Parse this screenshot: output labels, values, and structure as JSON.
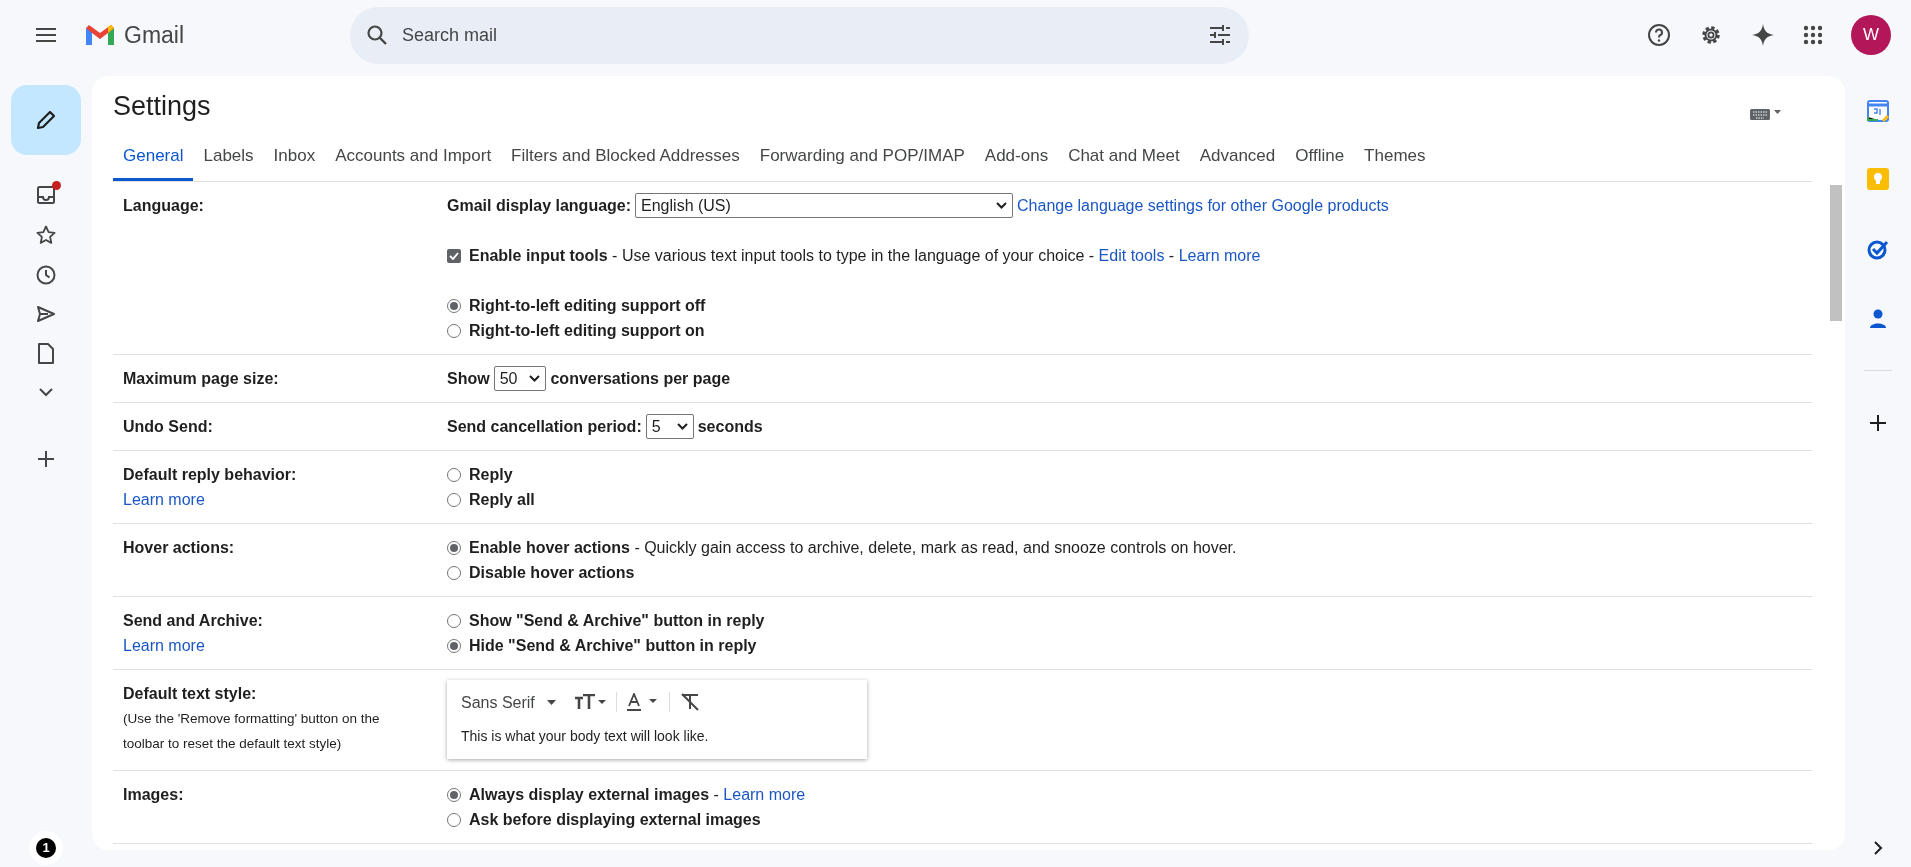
{
  "app": {
    "name": "Gmail"
  },
  "search": {
    "placeholder": "Search mail"
  },
  "account": {
    "initial": "W"
  },
  "nav": {
    "unread_dot": true
  },
  "bottom_badge": "1",
  "page_title": "Settings",
  "tabs": [
    {
      "label": "General",
      "selected": true
    },
    {
      "label": "Labels",
      "selected": false
    },
    {
      "label": "Inbox",
      "selected": false
    },
    {
      "label": "Accounts and Import",
      "selected": false
    },
    {
      "label": "Filters and Blocked Addresses",
      "selected": false
    },
    {
      "label": "Forwarding and POP/IMAP",
      "selected": false
    },
    {
      "label": "Add-ons",
      "selected": false
    },
    {
      "label": "Chat and Meet",
      "selected": false
    },
    {
      "label": "Advanced",
      "selected": false
    },
    {
      "label": "Offline",
      "selected": false
    },
    {
      "label": "Themes",
      "selected": false
    }
  ],
  "settings": [
    {
      "label": "Language:",
      "items": [
        {
          "kind": "line",
          "segments": [
            {
              "kind": "strong",
              "text": "Gmail display language:"
            },
            {
              "kind": "wide-select",
              "text": "English (US)"
            },
            {
              "kind": "link",
              "text": "Change language settings for other Google products"
            }
          ]
        },
        {
          "kind": "checkbox",
          "checked": true,
          "segments": [
            {
              "kind": "strong",
              "text": "Enable input tools"
            },
            {
              "kind": "text",
              "text": " - Use various text input tools to type in the language of your choice - "
            },
            {
              "kind": "link",
              "text": "Edit tools"
            },
            {
              "kind": "text",
              "text": " - "
            },
            {
              "kind": "link",
              "text": "Learn more"
            }
          ]
        },
        {
          "kind": "radio",
          "selected": true,
          "segments": [
            {
              "kind": "strong",
              "text": "Right-to-left editing support off"
            }
          ]
        },
        {
          "kind": "radio",
          "selected": false,
          "segments": [
            {
              "kind": "strong",
              "text": "Right-to-left editing support on"
            }
          ]
        }
      ]
    },
    {
      "label": "Maximum page size:",
      "items": [
        {
          "kind": "line",
          "segments": [
            {
              "kind": "strong",
              "text": "Show"
            },
            {
              "kind": "select",
              "text": "50"
            },
            {
              "kind": "strong",
              "text": "conversations per page"
            }
          ]
        }
      ]
    },
    {
      "label": "Undo Send:",
      "items": [
        {
          "kind": "line",
          "segments": [
            {
              "kind": "strong",
              "text": "Send cancellation period:"
            },
            {
              "kind": "select",
              "text": "5"
            },
            {
              "kind": "strong",
              "text": "seconds"
            }
          ]
        }
      ]
    },
    {
      "label": "Default reply behavior:",
      "link": "Learn more",
      "items": [
        {
          "kind": "radio",
          "selected": false,
          "segments": [
            {
              "kind": "strong",
              "text": "Reply"
            }
          ]
        },
        {
          "kind": "radio",
          "selected": false,
          "segments": [
            {
              "kind": "strong",
              "text": "Reply all"
            }
          ]
        }
      ]
    },
    {
      "label": "Hover actions:",
      "items": [
        {
          "kind": "radio",
          "selected": true,
          "segments": [
            {
              "kind": "strong",
              "text": "Enable hover actions"
            },
            {
              "kind": "text",
              "text": " - Quickly gain access to archive, delete, mark as read, and snooze controls on hover."
            }
          ]
        },
        {
          "kind": "radio",
          "selected": false,
          "segments": [
            {
              "kind": "strong",
              "text": "Disable hover actions"
            }
          ]
        }
      ]
    },
    {
      "label": "Send and Archive:",
      "link": "Learn more",
      "items": [
        {
          "kind": "radio",
          "selected": false,
          "segments": [
            {
              "kind": "strong",
              "text": "Show \"Send & Archive\" button in reply"
            }
          ]
        },
        {
          "kind": "radio",
          "selected": true,
          "segments": [
            {
              "kind": "strong",
              "text": "Hide \"Send & Archive\" button in reply"
            }
          ]
        }
      ]
    },
    {
      "label": "Default text style:",
      "note": "(Use the 'Remove formatting' button on the toolbar to reset the default text style)",
      "items": [
        {
          "kind": "editor",
          "font": "Sans Serif",
          "sample": "This is what your body text will look like."
        }
      ]
    },
    {
      "label": "Images:",
      "items": [
        {
          "kind": "radio",
          "selected": true,
          "segments": [
            {
              "kind": "strong",
              "text": "Always display external images"
            },
            {
              "kind": "text",
              "text": " - "
            },
            {
              "kind": "link",
              "text": "Learn more"
            }
          ]
        },
        {
          "kind": "radio",
          "selected": false,
          "segments": [
            {
              "kind": "strong",
              "text": "Ask before displaying external images"
            }
          ]
        }
      ]
    }
  ]
}
